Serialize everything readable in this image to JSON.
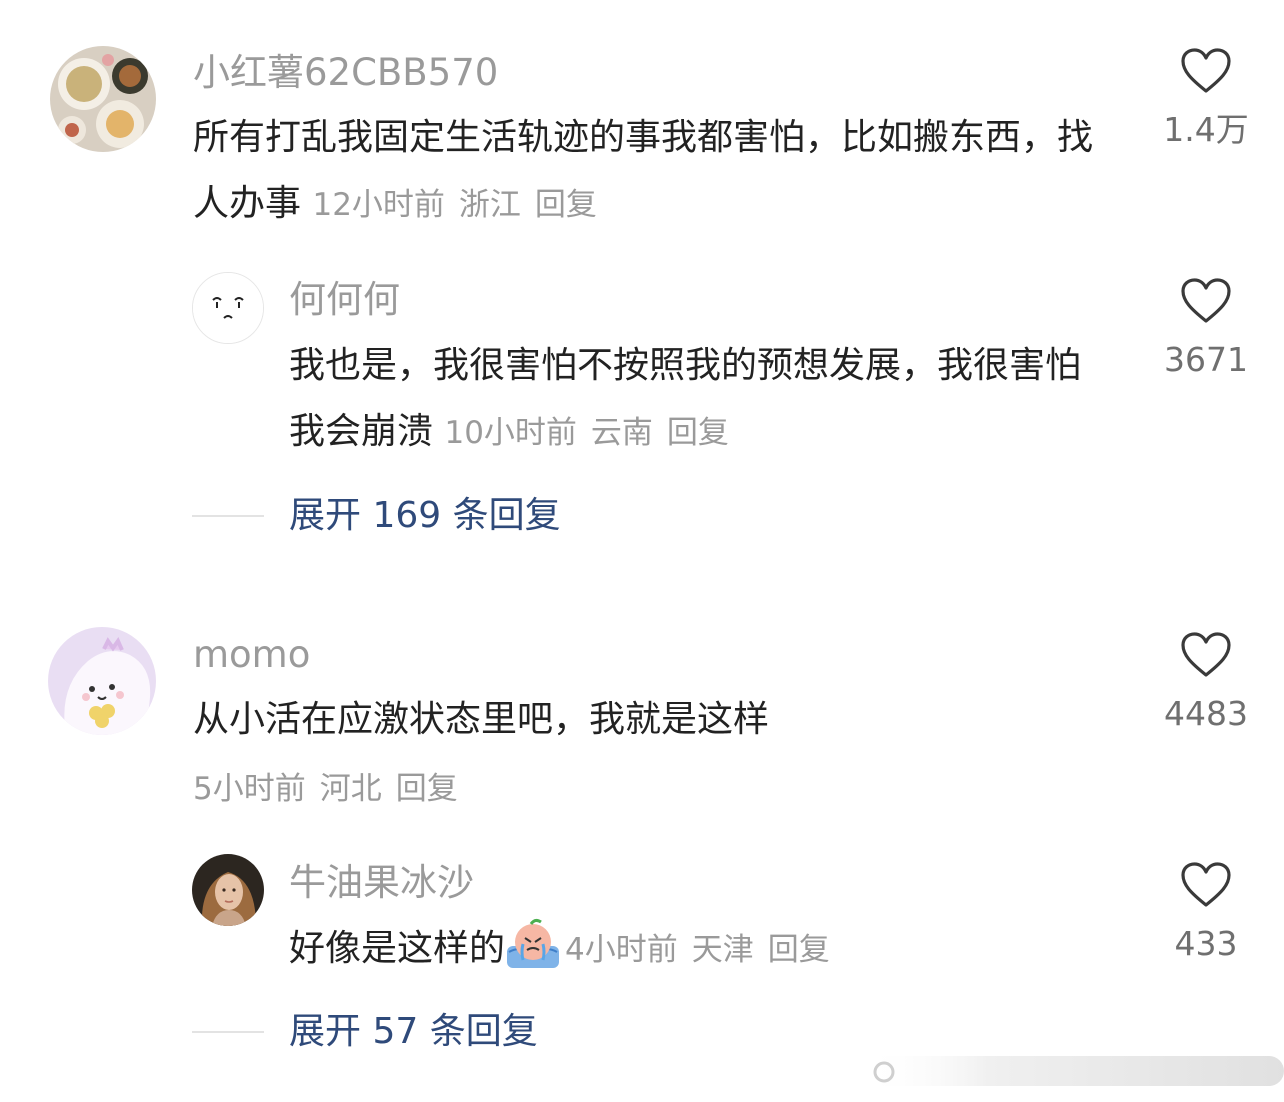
{
  "comments": [
    {
      "username": "小红薯62CBB570",
      "text": "所有打乱我固定生活轨迹的事我都害怕，比如搬东西，找人办事",
      "time": "12小时前",
      "location": "浙江",
      "reply_label": "回复",
      "likes": "1.4万",
      "avatar_icon": "food-plate-avatar",
      "replies": [
        {
          "username": "何何何",
          "text": "我也是，我很害怕不按照我的预想发展，我很害怕我会崩溃",
          "time": "10小时前",
          "location": "云南",
          "reply_label": "回复",
          "likes": "3671",
          "avatar_icon": "sad-face-avatar"
        }
      ],
      "expand_label": "展开 169 条回复"
    },
    {
      "username": "momo",
      "text": "从小活在应激状态里吧，我就是这样",
      "time": "5小时前",
      "location": "河北",
      "reply_label": "回复",
      "likes": "4483",
      "avatar_icon": "cartoon-monster-avatar",
      "replies": [
        {
          "username": "牛油果冰沙",
          "text": "好像是这样的",
          "time": "4小时前",
          "location": "天津",
          "reply_label": "回复",
          "likes": "433",
          "avatar_icon": "portrait-photo-avatar"
        }
      ],
      "expand_label": "展开 57 条回复"
    }
  ],
  "colors": {
    "username": "#9a9a9a",
    "text": "#222222",
    "expand_link": "#2f4a7a",
    "like_count": "#6f6f6f"
  }
}
